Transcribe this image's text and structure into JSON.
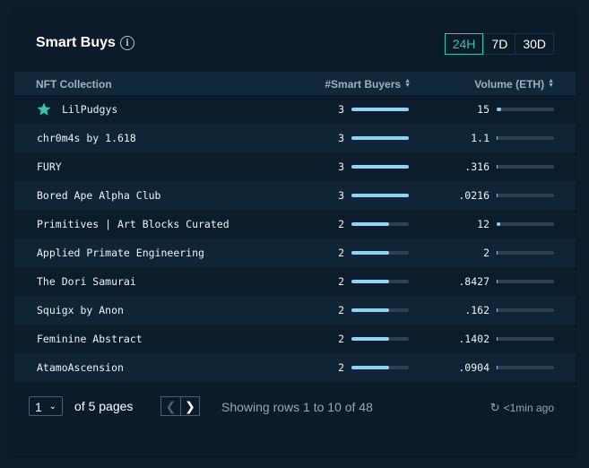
{
  "card": {
    "title": "Smart Buys",
    "info_icon": "info-icon",
    "timeframes": [
      {
        "label": "24H",
        "active": true
      },
      {
        "label": "7D",
        "active": false
      },
      {
        "label": "30D",
        "active": false
      }
    ]
  },
  "table": {
    "columns": {
      "name": "NFT Collection",
      "buyers": "#Smart Buyers",
      "volume": "Volume (ETH)"
    },
    "rows": [
      {
        "name": "LilPudgys",
        "buyers": "3",
        "buyers_pct": 1.0,
        "volume": "15",
        "volume_pct": 0.08,
        "star": true
      },
      {
        "name": "chr0m4s by 1.618",
        "buyers": "3",
        "buyers_pct": 1.0,
        "volume": "1.1",
        "volume_pct": 0.01,
        "star": false
      },
      {
        "name": "FURY",
        "buyers": "3",
        "buyers_pct": 1.0,
        "volume": ".316",
        "volume_pct": 0.01,
        "star": false
      },
      {
        "name": "Bored Ape Alpha Club",
        "buyers": "3",
        "buyers_pct": 1.0,
        "volume": ".0216",
        "volume_pct": 0.01,
        "star": false
      },
      {
        "name": "Primitives | Art Blocks Curated",
        "buyers": "2",
        "buyers_pct": 0.66,
        "volume": "12",
        "volume_pct": 0.06,
        "star": false
      },
      {
        "name": "Applied Primate Engineering",
        "buyers": "2",
        "buyers_pct": 0.66,
        "volume": "2",
        "volume_pct": 0.01,
        "star": false
      },
      {
        "name": "The Dori Samurai",
        "buyers": "2",
        "buyers_pct": 0.66,
        "volume": ".8427",
        "volume_pct": 0.01,
        "star": false
      },
      {
        "name": "Squigx by Anon",
        "buyers": "2",
        "buyers_pct": 0.66,
        "volume": ".162",
        "volume_pct": 0.01,
        "star": false
      },
      {
        "name": "Feminine Abstract",
        "buyers": "2",
        "buyers_pct": 0.66,
        "volume": ".1402",
        "volume_pct": 0.01,
        "star": false
      },
      {
        "name": "AtamoAscension",
        "buyers": "2",
        "buyers_pct": 0.66,
        "volume": ".0904",
        "volume_pct": 0.01,
        "star": false
      }
    ]
  },
  "footer": {
    "page_value": "1",
    "of_pages": "of 5 pages",
    "prev_icon": "chevron-left-icon",
    "next_icon": "chevron-right-icon",
    "showing": "Showing rows 1 to 10 of 48",
    "updated": "<1min ago"
  },
  "colors": {
    "background": "#0b1b2a",
    "accent": "#35c2b0",
    "bar": "#8dd3f5",
    "star": "#35c2b0"
  }
}
